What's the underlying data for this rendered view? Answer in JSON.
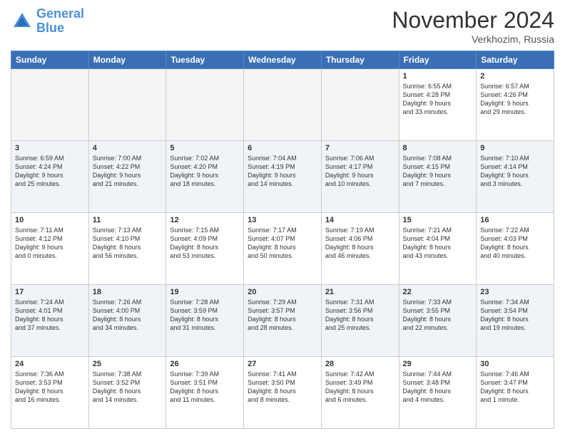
{
  "header": {
    "logo_line1": "General",
    "logo_line2": "Blue",
    "month": "November 2024",
    "location": "Verkhozim, Russia"
  },
  "weekdays": [
    "Sunday",
    "Monday",
    "Tuesday",
    "Wednesday",
    "Thursday",
    "Friday",
    "Saturday"
  ],
  "weeks": [
    [
      {
        "day": "",
        "info": ""
      },
      {
        "day": "",
        "info": ""
      },
      {
        "day": "",
        "info": ""
      },
      {
        "day": "",
        "info": ""
      },
      {
        "day": "",
        "info": ""
      },
      {
        "day": "1",
        "info": "Sunrise: 6:55 AM\nSunset: 4:28 PM\nDaylight: 9 hours\nand 33 minutes."
      },
      {
        "day": "2",
        "info": "Sunrise: 6:57 AM\nSunset: 4:26 PM\nDaylight: 9 hours\nand 29 minutes."
      }
    ],
    [
      {
        "day": "3",
        "info": "Sunrise: 6:59 AM\nSunset: 4:24 PM\nDaylight: 9 hours\nand 25 minutes."
      },
      {
        "day": "4",
        "info": "Sunrise: 7:00 AM\nSunset: 4:22 PM\nDaylight: 9 hours\nand 21 minutes."
      },
      {
        "day": "5",
        "info": "Sunrise: 7:02 AM\nSunset: 4:20 PM\nDaylight: 9 hours\nand 18 minutes."
      },
      {
        "day": "6",
        "info": "Sunrise: 7:04 AM\nSunset: 4:19 PM\nDaylight: 9 hours\nand 14 minutes."
      },
      {
        "day": "7",
        "info": "Sunrise: 7:06 AM\nSunset: 4:17 PM\nDaylight: 9 hours\nand 10 minutes."
      },
      {
        "day": "8",
        "info": "Sunrise: 7:08 AM\nSunset: 4:15 PM\nDaylight: 9 hours\nand 7 minutes."
      },
      {
        "day": "9",
        "info": "Sunrise: 7:10 AM\nSunset: 4:14 PM\nDaylight: 9 hours\nand 3 minutes."
      }
    ],
    [
      {
        "day": "10",
        "info": "Sunrise: 7:11 AM\nSunset: 4:12 PM\nDaylight: 9 hours\nand 0 minutes."
      },
      {
        "day": "11",
        "info": "Sunrise: 7:13 AM\nSunset: 4:10 PM\nDaylight: 8 hours\nand 56 minutes."
      },
      {
        "day": "12",
        "info": "Sunrise: 7:15 AM\nSunset: 4:09 PM\nDaylight: 8 hours\nand 53 minutes."
      },
      {
        "day": "13",
        "info": "Sunrise: 7:17 AM\nSunset: 4:07 PM\nDaylight: 8 hours\nand 50 minutes."
      },
      {
        "day": "14",
        "info": "Sunrise: 7:19 AM\nSunset: 4:06 PM\nDaylight: 8 hours\nand 46 minutes."
      },
      {
        "day": "15",
        "info": "Sunrise: 7:21 AM\nSunset: 4:04 PM\nDaylight: 8 hours\nand 43 minutes."
      },
      {
        "day": "16",
        "info": "Sunrise: 7:22 AM\nSunset: 4:03 PM\nDaylight: 8 hours\nand 40 minutes."
      }
    ],
    [
      {
        "day": "17",
        "info": "Sunrise: 7:24 AM\nSunset: 4:01 PM\nDaylight: 8 hours\nand 37 minutes."
      },
      {
        "day": "18",
        "info": "Sunrise: 7:26 AM\nSunset: 4:00 PM\nDaylight: 8 hours\nand 34 minutes."
      },
      {
        "day": "19",
        "info": "Sunrise: 7:28 AM\nSunset: 3:59 PM\nDaylight: 8 hours\nand 31 minutes."
      },
      {
        "day": "20",
        "info": "Sunrise: 7:29 AM\nSunset: 3:57 PM\nDaylight: 8 hours\nand 28 minutes."
      },
      {
        "day": "21",
        "info": "Sunrise: 7:31 AM\nSunset: 3:56 PM\nDaylight: 8 hours\nand 25 minutes."
      },
      {
        "day": "22",
        "info": "Sunrise: 7:33 AM\nSunset: 3:55 PM\nDaylight: 8 hours\nand 22 minutes."
      },
      {
        "day": "23",
        "info": "Sunrise: 7:34 AM\nSunset: 3:54 PM\nDaylight: 8 hours\nand 19 minutes."
      }
    ],
    [
      {
        "day": "24",
        "info": "Sunrise: 7:36 AM\nSunset: 3:53 PM\nDaylight: 8 hours\nand 16 minutes."
      },
      {
        "day": "25",
        "info": "Sunrise: 7:38 AM\nSunset: 3:52 PM\nDaylight: 8 hours\nand 14 minutes."
      },
      {
        "day": "26",
        "info": "Sunrise: 7:39 AM\nSunset: 3:51 PM\nDaylight: 8 hours\nand 11 minutes."
      },
      {
        "day": "27",
        "info": "Sunrise: 7:41 AM\nSunset: 3:50 PM\nDaylight: 8 hours\nand 8 minutes."
      },
      {
        "day": "28",
        "info": "Sunrise: 7:42 AM\nSunset: 3:49 PM\nDaylight: 8 hours\nand 6 minutes."
      },
      {
        "day": "29",
        "info": "Sunrise: 7:44 AM\nSunset: 3:48 PM\nDaylight: 8 hours\nand 4 minutes."
      },
      {
        "day": "30",
        "info": "Sunrise: 7:46 AM\nSunset: 3:47 PM\nDaylight: 8 hours\nand 1 minute."
      }
    ]
  ]
}
